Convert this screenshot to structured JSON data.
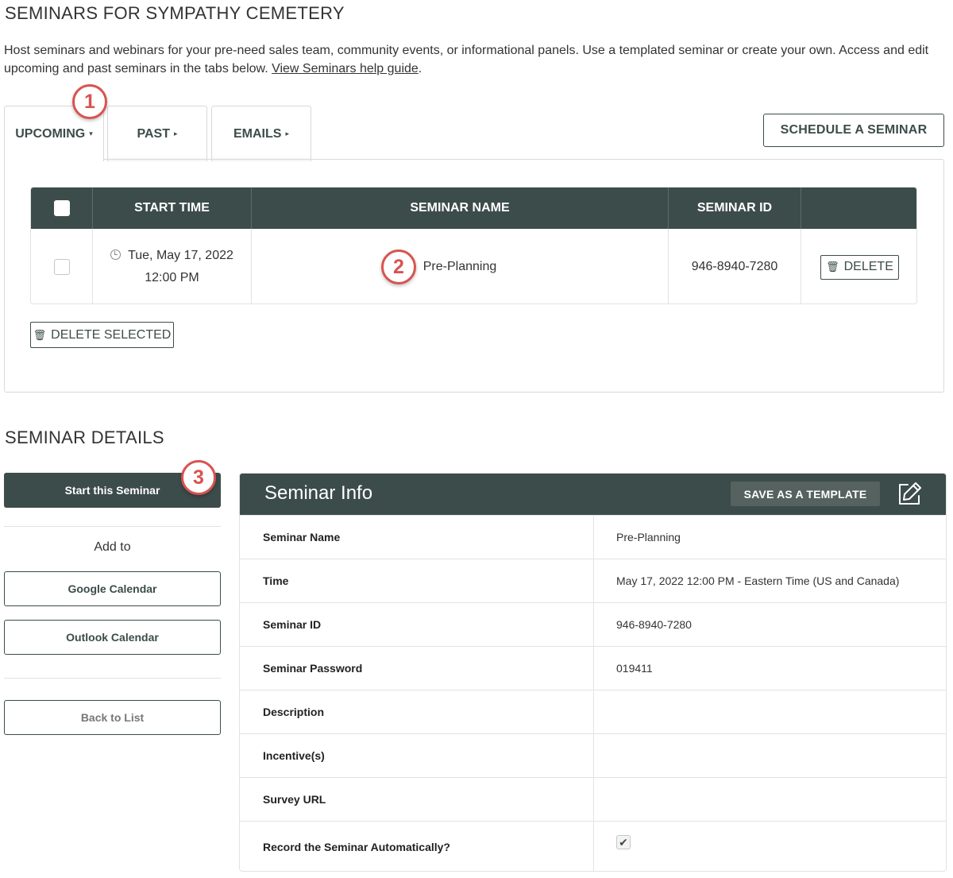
{
  "page": {
    "title": "SEMINARS FOR SYMPATHY CEMETERY",
    "intro_text": "Host seminars and webinars for your pre-need sales team, community events, or informational panels. Use a templated seminar or create your own. Access and edit upcoming and past seminars in the tabs below.",
    "help_link": "View Seminars help guide",
    "intro_end": "."
  },
  "tabs": [
    {
      "label": "UPCOMING",
      "caret": "▾",
      "active": true
    },
    {
      "label": "PAST",
      "caret": "▸",
      "active": false
    },
    {
      "label": "EMAILS",
      "caret": "▸",
      "active": false
    }
  ],
  "schedule_button": "SCHEDULE A SEMINAR",
  "table": {
    "headers": [
      "START TIME",
      "SEMINAR NAME",
      "SEMINAR ID"
    ],
    "rows": [
      {
        "date": "Tue, May 17, 2022",
        "time": "12:00 PM",
        "name": "Pre-Planning",
        "id": "946-8940-7280",
        "delete_label": "DELETE"
      }
    ]
  },
  "delete_selected": "DELETE SELECTED",
  "badges": [
    "1",
    "2",
    "3"
  ],
  "details": {
    "title": "SEMINAR DETAILS",
    "start_button": "Start this Seminar",
    "add_to": "Add to",
    "google_calendar": "Google Calendar",
    "outlook_calendar": "Outlook Calendar",
    "back_to_list": "Back to List"
  },
  "info": {
    "title": "Seminar Info",
    "save_template": "SAVE AS A TEMPLATE",
    "rows": [
      {
        "key": "Seminar Name",
        "value": "Pre-Planning"
      },
      {
        "key": "Time",
        "value": "May 17, 2022 12:00 PM - Eastern Time (US and Canada)"
      },
      {
        "key": "Seminar ID",
        "value": "946-8940-7280"
      },
      {
        "key": "Seminar Password",
        "value": "019411"
      },
      {
        "key": "Description",
        "value": ""
      },
      {
        "key": "Incentive(s)",
        "value": ""
      },
      {
        "key": "Survey URL",
        "value": ""
      },
      {
        "key": "Record the Seminar Automatically?",
        "value": "",
        "checked": true
      }
    ]
  },
  "icons": {
    "clock": "clock-icon",
    "trash": "trash-icon",
    "edit": "edit-icon",
    "check": "checkmark-icon"
  },
  "colors": {
    "header_bg": "#3c4c4a",
    "accent_red": "#d9534f"
  }
}
